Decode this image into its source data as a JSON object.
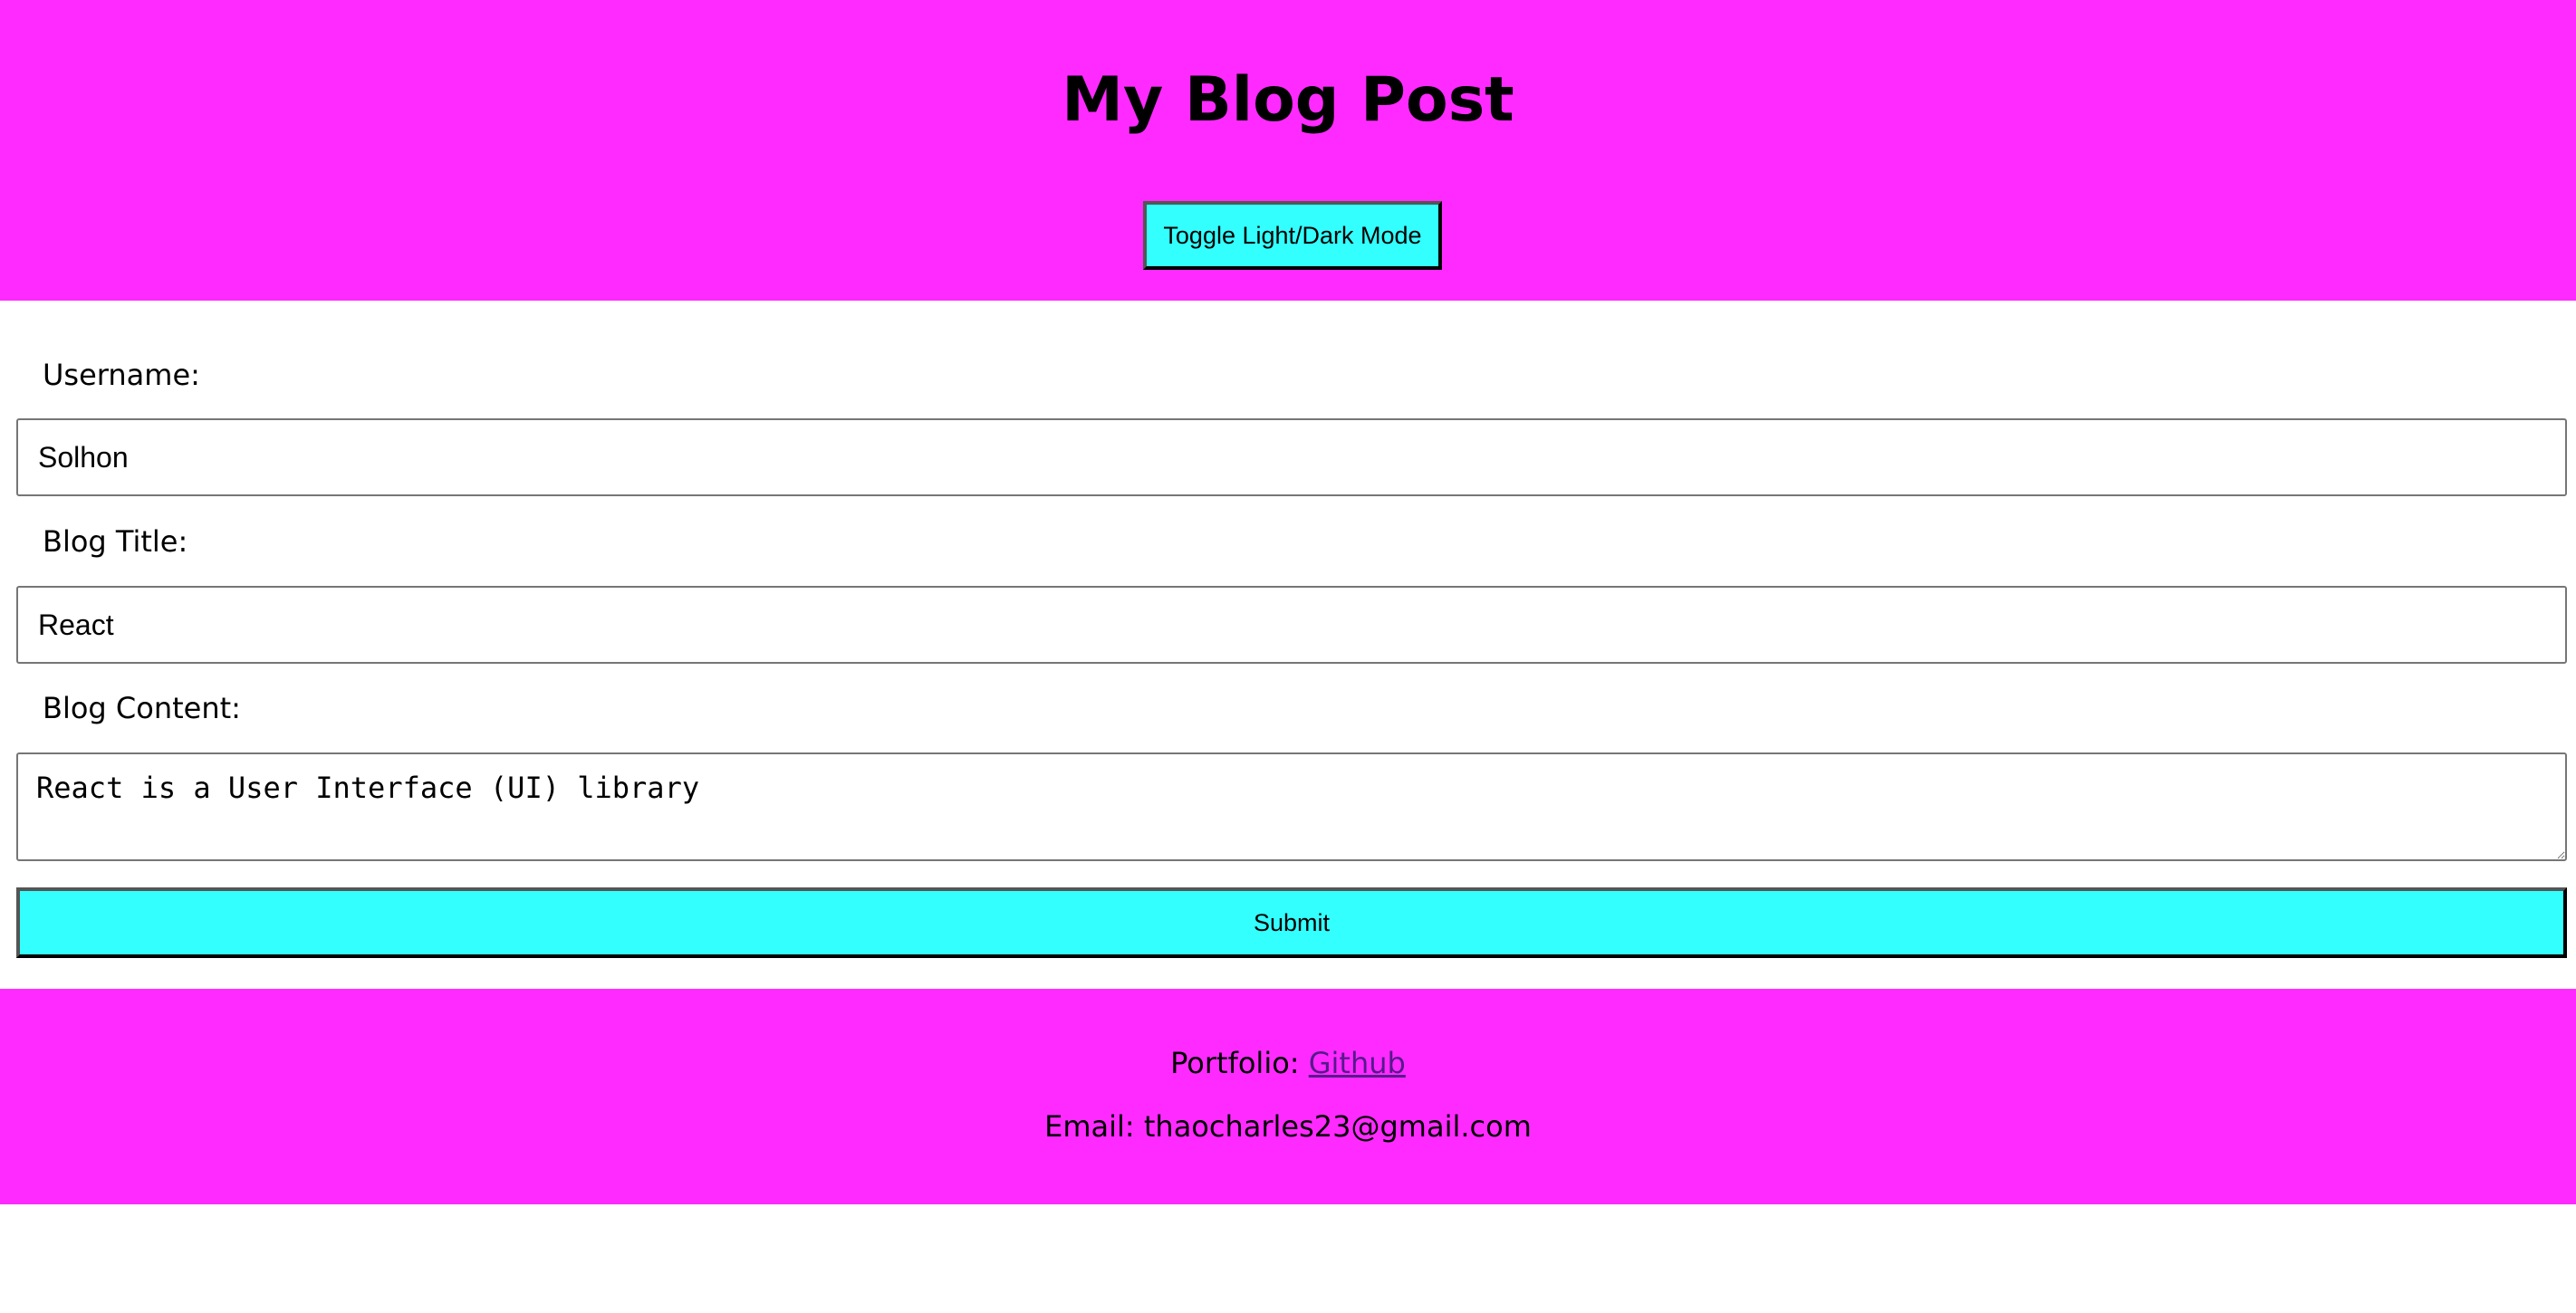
{
  "header": {
    "title": "My Blog Post",
    "toggle_label": "Toggle Light/Dark Mode"
  },
  "form": {
    "username_label": "Username:",
    "username_value": "Solhon",
    "title_label": "Blog Title:",
    "title_value": "React",
    "content_label": "Blog Content:",
    "content_value": "React is a User Interface (UI) library",
    "submit_label": "Submit"
  },
  "footer": {
    "portfolio_prefix": "Portfolio: ",
    "portfolio_link": "Github",
    "email_text": "Email: thaocharles23@gmail.com"
  },
  "colors": {
    "header_bg": "#ff2aff",
    "button_bg": "#33ffff",
    "link": "#551a8b"
  }
}
